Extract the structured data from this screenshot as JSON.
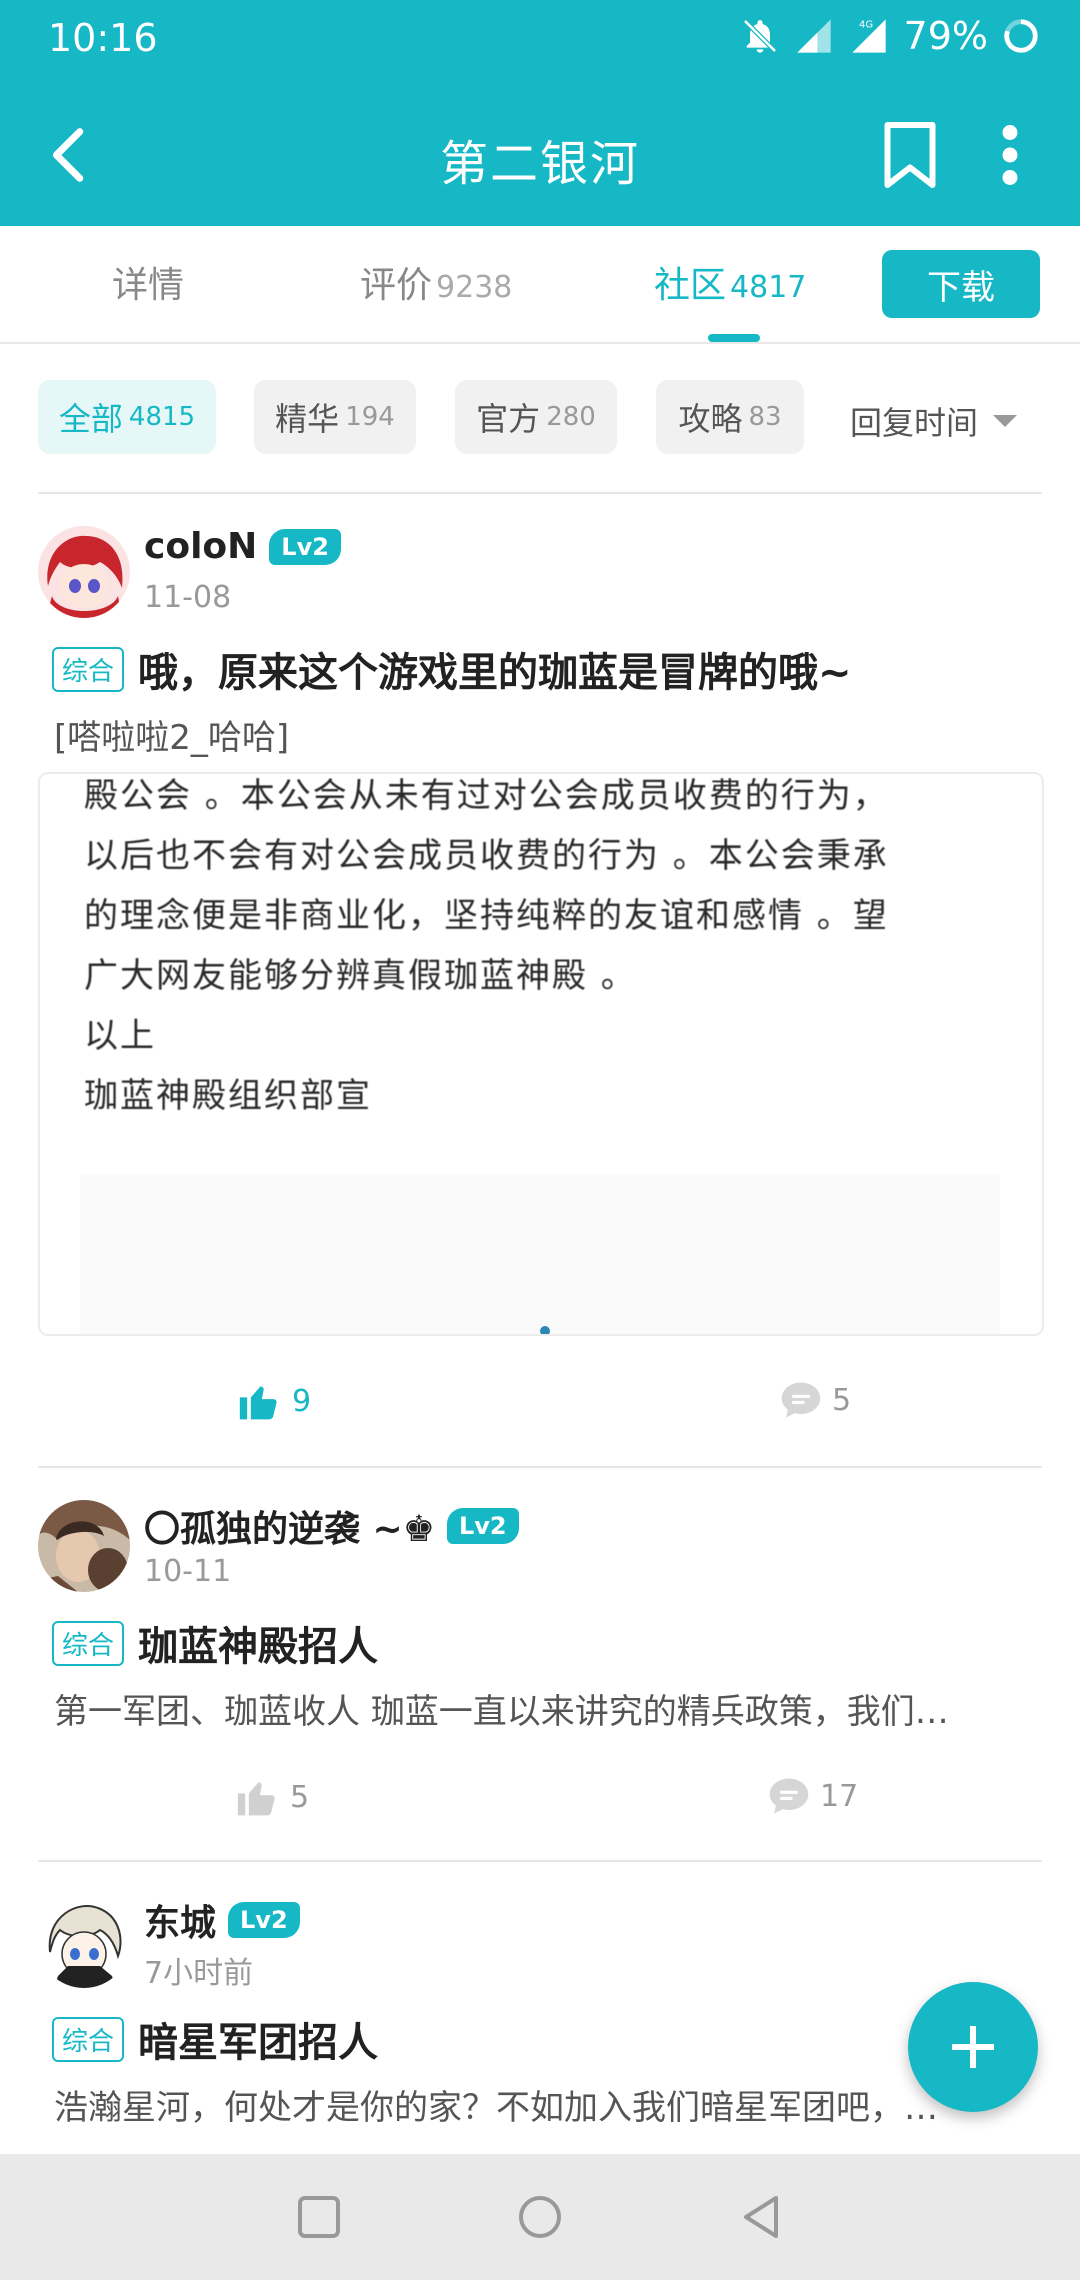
{
  "status": {
    "time": "10:16",
    "battery": "79%",
    "network": "4G"
  },
  "toolbar": {
    "title": "第二银河"
  },
  "tabs": [
    {
      "label": "详情",
      "count": ""
    },
    {
      "label": "评价",
      "count": "9238"
    },
    {
      "label": "社区",
      "count": "4817"
    }
  ],
  "download_label": "下载",
  "filters": [
    {
      "label": "全部",
      "count": "4815"
    },
    {
      "label": "精华",
      "count": "194"
    },
    {
      "label": "官方",
      "count": "280"
    },
    {
      "label": "攻略",
      "count": "83"
    }
  ],
  "sort_label": "回复时间",
  "posts": [
    {
      "user": "coloN",
      "level": "Lv2",
      "date": "11-08",
      "tag": "综合",
      "title": "哦，原来这个游戏里的珈蓝是冒牌的哦~",
      "excerpt": "[嗒啦啦2_哈哈]",
      "image_lines": [
        "殿公会 。本公会从未有过对公会成员收费的行为，",
        "以后也不会有对公会成员收费的行为 。本公会秉承",
        "的理念便是非商业化，坚持纯粹的友谊和感情 。望",
        "广大网友能够分辨真假珈蓝神殿 。",
        " 以上",
        "珈蓝神殿组织部宣"
      ],
      "likes": "9",
      "comments": "5"
    },
    {
      "user": "〇孤独的逆袭 ~♚",
      "level": "Lv2",
      "date": "10-11",
      "tag": "综合",
      "title": "珈蓝神殿招人",
      "excerpt": "第一军团、珈蓝收人 珈蓝一直以来讲究的精兵政策，我们…",
      "likes": "5",
      "comments": "17"
    },
    {
      "user": "东城",
      "level": "Lv2",
      "date": "7小时前",
      "tag": "综合",
      "title": "暗星军团招人",
      "excerpt": "浩瀚星河，何处才是你的家？不如加入我们暗星军团吧，…"
    }
  ],
  "colors": {
    "accent": "#16b8c6"
  }
}
